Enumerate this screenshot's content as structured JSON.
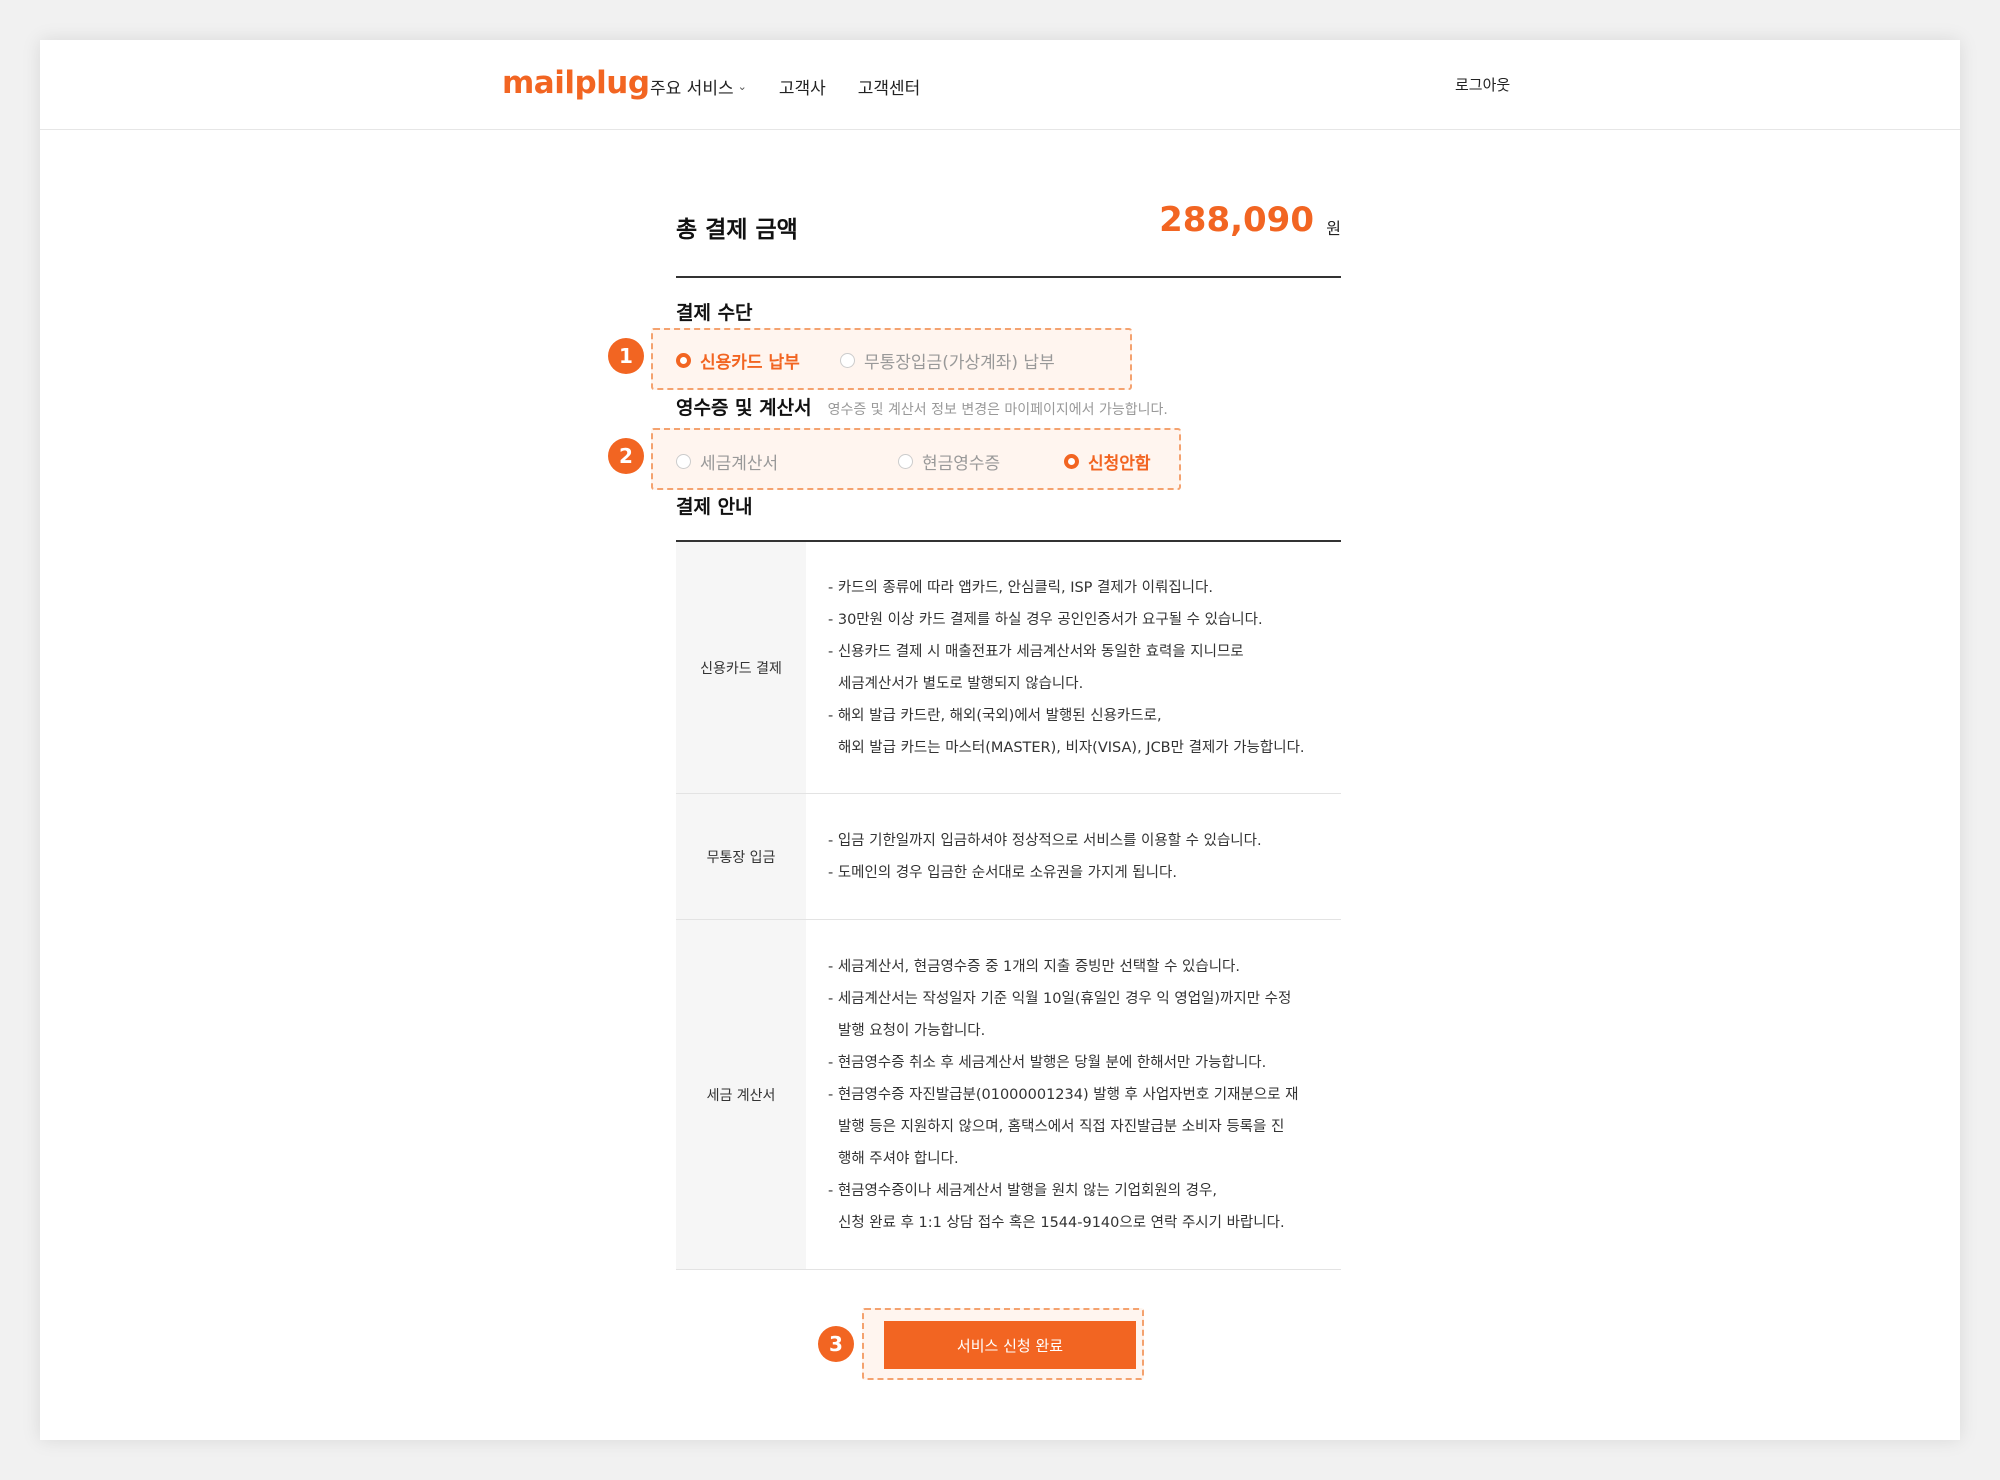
{
  "header": {
    "logo": "mailplug",
    "nav": [
      {
        "label": "주요 서비스",
        "has_dropdown": true
      },
      {
        "label": "고객사",
        "has_dropdown": false
      },
      {
        "label": "고객센터",
        "has_dropdown": false
      }
    ],
    "logout": "로그아웃"
  },
  "total": {
    "label": "총 결제 금액",
    "amount": "288,090",
    "unit": "원"
  },
  "payment_method": {
    "title": "결제 수단",
    "marker": "1",
    "options": [
      {
        "label": "신용카드 납부",
        "selected": true
      },
      {
        "label": "무통장입금(가상계좌) 납부",
        "selected": false
      }
    ]
  },
  "receipt": {
    "title": "영수증 및 계산서",
    "note": "영수증 및 계산서 정보 변경은 마이페이지에서 가능합니다.",
    "marker": "2",
    "options": [
      {
        "label": "세금계산서",
        "selected": false
      },
      {
        "label": "현금영수증",
        "selected": false
      },
      {
        "label": "신청안함",
        "selected": true
      }
    ]
  },
  "guide": {
    "title": "결제 안내",
    "rows": [
      {
        "head": "신용카드 결제",
        "lines": [
          "- 카드의 종류에 따라 앱카드, 안심클릭, ISP 결제가 이뤄집니다.",
          "- 30만원 이상 카드 결제를 하실 경우 공인인증서가 요구될 수 있습니다.",
          "- 신용카드 결제 시 매출전표가 세금계산서와 동일한 효력을 지니므로",
          "세금계산서가 별도로 발행되지 않습니다.",
          "- 해외 발급 카드란, 해외(국외)에서 발행된 신용카드로,",
          "해외 발급 카드는 마스터(MASTER), 비자(VISA), JCB만 결제가 가능합니다."
        ]
      },
      {
        "head": "무통장 입금",
        "lines": [
          "- 입금 기한일까지 입금하셔야 정상적으로 서비스를 이용할 수 있습니다.",
          "- 도메인의 경우 입금한 순서대로 소유권을 가지게 됩니다."
        ]
      },
      {
        "head": "세금 계산서",
        "lines": [
          "- 세금계산서, 현금영수증 중 1개의 지출 증빙만 선택할 수 있습니다.",
          "- 세금계산서는 작성일자 기준 익월 10일(휴일인 경우 익 영업일)까지만 수정",
          "발행 요청이 가능합니다.",
          "- 현금영수증 취소 후 세금계산서 발행은 당월 분에 한해서만 가능합니다.",
          "- 현금영수증 자진발급분(01000001234) 발행 후 사업자번호 기재분으로 재",
          "발행 등은 지원하지 않으며, 홈택스에서 직접 자진발급분 소비자 등록을 진",
          "행해 주셔야 합니다.",
          "- 현금영수증이나 세금계산서 발행을 원치 않는 기업회원의 경우,",
          "신청 완료 후 1:1 상담 접수 혹은 1544-9140으로 연락 주시기 바랍니다."
        ]
      }
    ]
  },
  "submit": {
    "marker": "3",
    "label": "서비스 신청 완료"
  },
  "colors": {
    "accent": "#f26522",
    "highlight_bg": "#fff5ef",
    "highlight_border": "#f4a26f"
  }
}
